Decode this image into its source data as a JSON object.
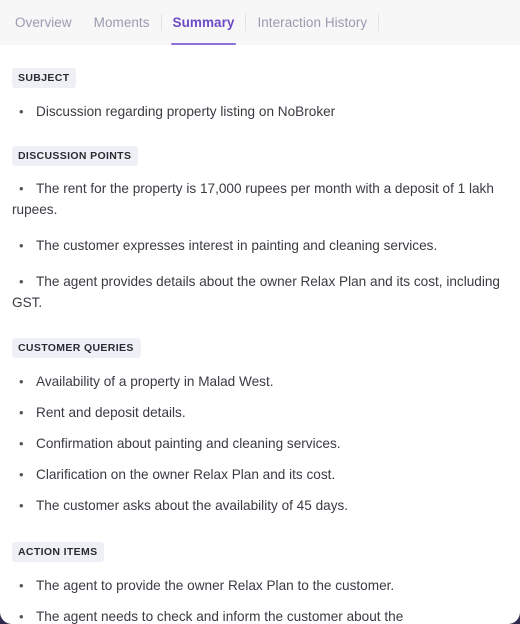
{
  "tabs": [
    {
      "label": "Overview",
      "active": false,
      "separator_after": false
    },
    {
      "label": "Moments",
      "active": false,
      "separator_after": true
    },
    {
      "label": "Summary",
      "active": true,
      "separator_after": true
    },
    {
      "label": "Interaction History",
      "active": false,
      "separator_after": true
    }
  ],
  "colors": {
    "active_tab": "#6e4bc7",
    "active_underline": "#8b6fd4",
    "inactive_tab": "#9a9bb0",
    "badge_bg": "#eef0f6",
    "badge_text": "#2b2b35",
    "body_text": "#3a3a42",
    "tabbar_bg": "#f7f7f8",
    "page_bg": "#ffffff"
  },
  "sections": {
    "subject": {
      "title": "SUBJECT",
      "items": [
        "Discussion regarding property listing on NoBroker"
      ]
    },
    "discussion_points": {
      "title": "DISCUSSION POINTS",
      "items": [
        "The rent for the property is 17,000 rupees per month with a deposit of 1 lakh rupees.",
        "The customer expresses interest in painting and cleaning services.",
        "The agent provides details about the owner Relax Plan and its cost, including GST."
      ]
    },
    "customer_queries": {
      "title": "CUSTOMER QUERIES",
      "items": [
        "Availability of a property in Malad West.",
        "Rent and deposit details.",
        "Confirmation about painting and cleaning services.",
        "Clarification on the owner Relax Plan and its cost.",
        "The customer asks about the availability of 45 days."
      ]
    },
    "action_items": {
      "title": "ACTION ITEMS",
      "items": [
        "The agent to provide the owner Relax Plan to the customer.",
        "The agent needs to check and inform the customer about the"
      ]
    }
  }
}
